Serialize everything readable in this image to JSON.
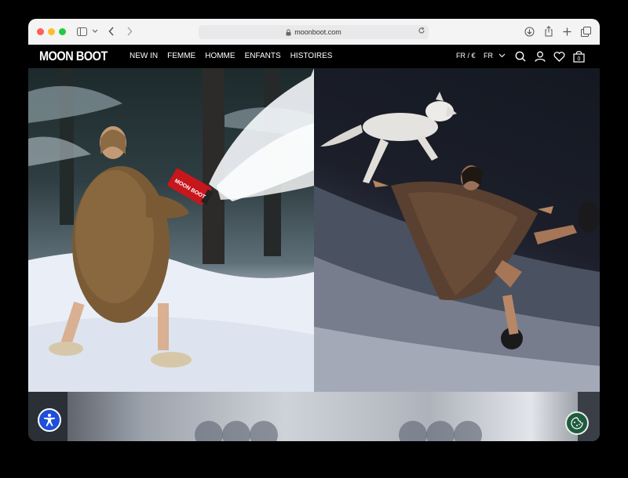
{
  "browser": {
    "url": "moonboot.com",
    "icons": [
      "sidebar-icon",
      "chevron-down-icon",
      "back-icon",
      "forward-icon",
      "lock-icon",
      "reload-icon",
      "download-icon",
      "share-icon",
      "new-tab-icon",
      "tabs-overview-icon"
    ]
  },
  "site": {
    "logo": "MOON BOOT",
    "nav": [
      "NEW IN",
      "FEMME",
      "HOMME",
      "ENFANTS",
      "HISTOIRES"
    ],
    "currency": "FR / €",
    "language": "FR",
    "icons": [
      "search-icon",
      "account-icon",
      "wishlist-heart-icon",
      "cart-bag-icon"
    ],
    "cart_count": "0"
  },
  "hero": {
    "left_image": "woman-fur-coat-snow-cannon",
    "right_image": "woman-fur-coat-wolf-night",
    "snow_gun_text": "MOON BOOT"
  },
  "colors": {
    "accessibility_button": "#1f4fd8",
    "cookie_button": "#1f5b3f",
    "header_bg": "#000000"
  }
}
